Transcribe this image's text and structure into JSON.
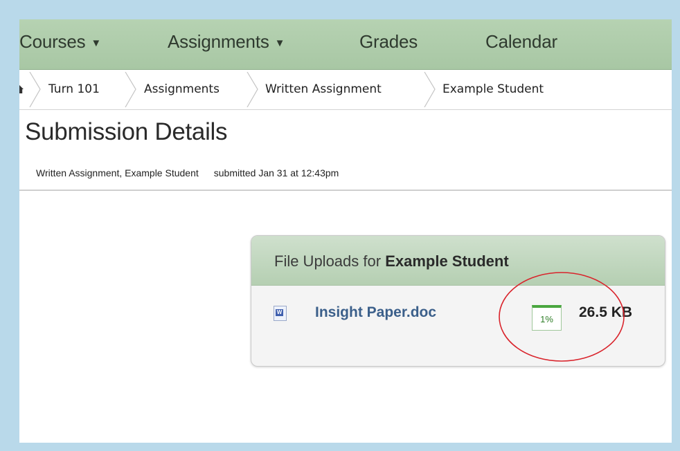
{
  "nav": {
    "courses": "Courses",
    "assignments": "Assignments",
    "grades": "Grades",
    "calendar": "Calendar"
  },
  "breadcrumb": [
    "Turn 101",
    "Assignments",
    "Written Assignment",
    "Example Student"
  ],
  "page": {
    "title": "Submission Details",
    "assignment_student": "Written Assignment, Example Student",
    "submitted": "submitted Jan 31 at 12:43pm"
  },
  "uploads": {
    "title_prefix": "File Uploads for ",
    "student": "Example Student",
    "file_name": "Insight Paper.doc",
    "similarity": "1%",
    "file_size": "26.5 KB"
  },
  "colors": {
    "nav_bg": "#b6d2b2",
    "link": "#3b5f8a",
    "similarity_green": "#4aa63f",
    "annotation_circle": "#d9232b"
  },
  "icons": {
    "caret": "caret-down-icon",
    "home": "home-icon",
    "doc": "word-doc-icon"
  }
}
